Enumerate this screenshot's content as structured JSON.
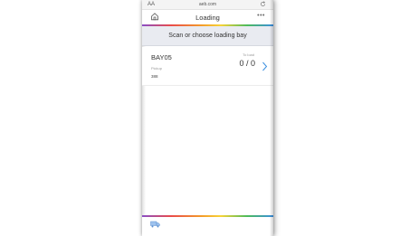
{
  "browser": {
    "text_size_label": "AA",
    "url": "aeb.com",
    "reload_icon": "reload-icon"
  },
  "header": {
    "title": "Loading",
    "home_icon": "home-icon",
    "more_label": "•••"
  },
  "banner": {
    "text": "Scan or choose loading bay"
  },
  "bays": [
    {
      "name": "BAY05",
      "to_load_label": "To load",
      "to_load_value": "0 / 0",
      "pickup_label": "Pickup",
      "pickup_value": "388"
    }
  ],
  "footer": {
    "icon": "truck-icon"
  },
  "colors": {
    "banner_bg": "#e9ebf1",
    "accent_blue": "#3b8fe0",
    "rainbow": [
      "#8a4fc7",
      "#e94b4b",
      "#f39a2a",
      "#f7d337",
      "#4cbb5b",
      "#3b8fe0"
    ]
  }
}
